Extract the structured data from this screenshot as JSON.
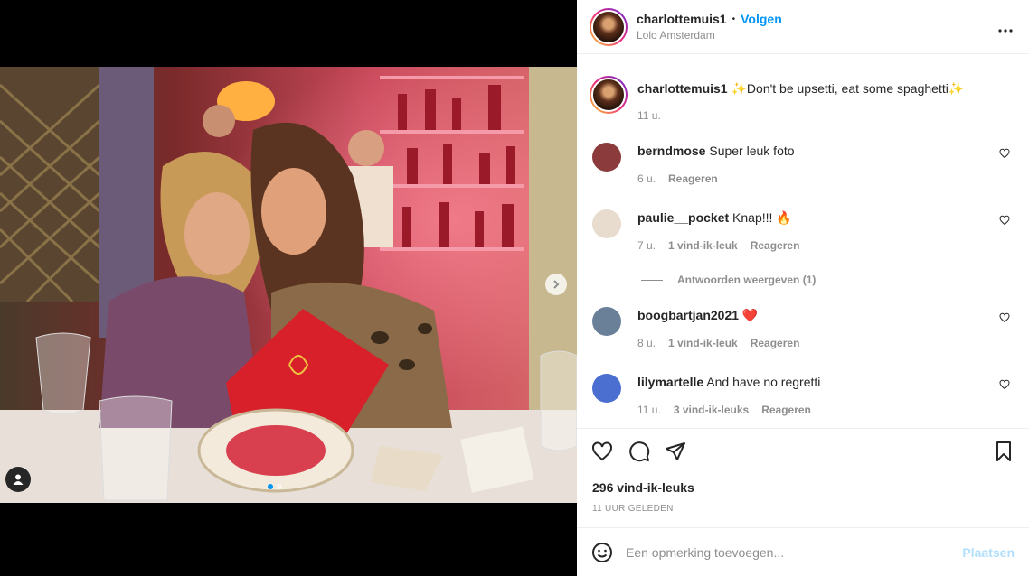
{
  "header": {
    "username": "charlottemuis1",
    "separator": "•",
    "follow_label": "Volgen",
    "location": "Lolo Amsterdam",
    "more_icon": "more-horizontal-icon"
  },
  "caption": {
    "username": "charlottemuis1",
    "text": "✨Don't be upsetti, eat some spaghetti✨",
    "time": "11 u."
  },
  "comments": [
    {
      "username": "berndmose",
      "text": "Super leuk foto",
      "time": "6 u.",
      "likes": "",
      "reply_label": "Reageren",
      "avatar_color": "#8b3b3b"
    },
    {
      "username": "paulie__pocket",
      "text": "Knap!!! 🔥",
      "time": "7 u.",
      "likes": "1 vind-ik-leuk",
      "reply_label": "Reageren",
      "avatar_color": "#e8dccf"
    },
    {
      "username": "boogbartjan2021",
      "text": "❤️",
      "time": "8 u.",
      "likes": "1 vind-ik-leuk",
      "reply_label": "Reageren",
      "avatar_color": "#6a7f98"
    },
    {
      "username": "lilymartelle",
      "text": "And have no regretti",
      "time": "11 u.",
      "likes": "3 vind-ik-leuks",
      "reply_label": "Reageren",
      "avatar_color": "#4a6fd1"
    }
  ],
  "view_replies": "Antwoorden weergeven (1)",
  "likes": "296 vind-ik-leuks",
  "timestamp": "11 UUR GELEDEN",
  "add_comment": {
    "placeholder": "Een opmerking toevoegen...",
    "post_label": "Plaatsen"
  },
  "colors": {
    "accent": "#0095f6",
    "post_disabled": "#b2dffc",
    "muted": "#8e8e8e"
  }
}
